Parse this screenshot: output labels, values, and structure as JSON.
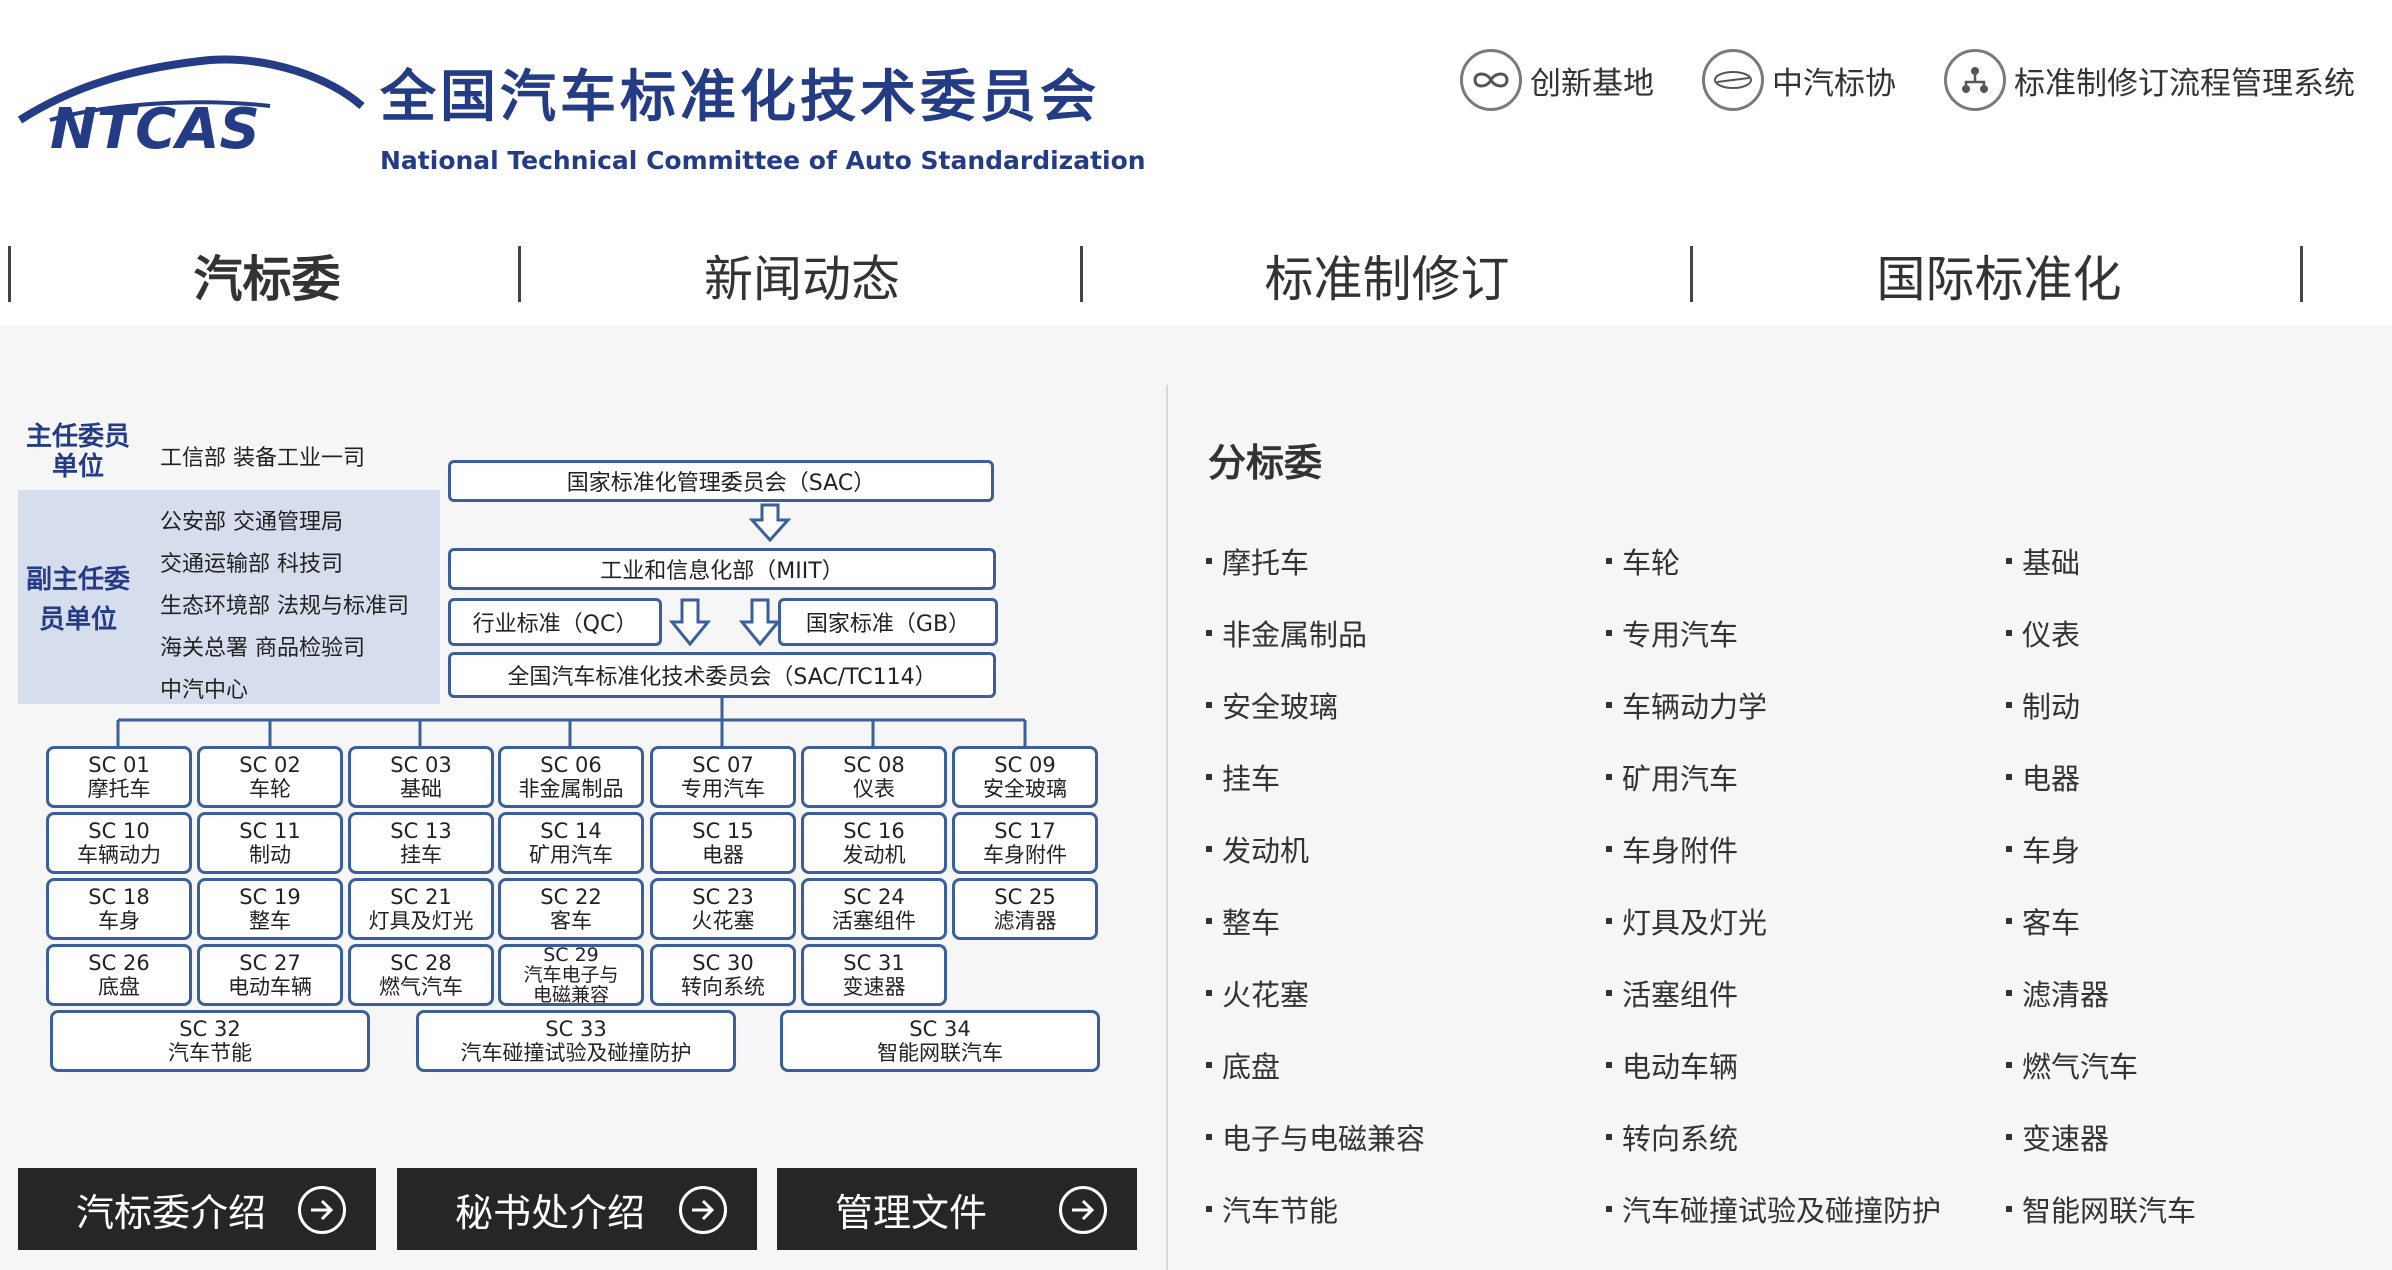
{
  "header": {
    "logo_text": "NTCAS",
    "title_cn": "全国汽车标准化技术委员会",
    "title_en": "National Technical Committee of Auto Standardization",
    "quick_links": [
      {
        "label": "创新基地",
        "icon": "infinity-link-icon"
      },
      {
        "label": "中汽标协",
        "icon": "casc-logo-icon"
      },
      {
        "label": "标准制修订流程管理系统",
        "icon": "org-flow-icon"
      }
    ]
  },
  "nav": {
    "items": [
      "汽标委",
      "新闻动态",
      "标准制修订",
      "国际标准化"
    ],
    "active": "汽标委"
  },
  "org_chart": {
    "main_label": "主任委员单位",
    "main_unit": "工信部  装备工业一司",
    "vice_label": "副主任委员单位",
    "vice_units": [
      "公安部  交通管理局",
      "交通运输部  科技司",
      "生态环境部  法规与标准司",
      "海关总署  商品检验司",
      "中汽中心"
    ],
    "sac": "国家标准化管理委员会（SAC）",
    "miit": "工业和信息化部（MIIT）",
    "qc": "行业标准（QC）",
    "gb": "国家标准（GB）",
    "tc114": "全国汽车标准化技术委员会（SAC/TC114）",
    "sc": [
      {
        "code": "SC 01",
        "name": "摩托车"
      },
      {
        "code": "SC 02",
        "name": "车轮"
      },
      {
        "code": "SC 03",
        "name": "基础"
      },
      {
        "code": "SC 06",
        "name": "非金属制品"
      },
      {
        "code": "SC 07",
        "name": "专用汽车"
      },
      {
        "code": "SC 08",
        "name": "仪表"
      },
      {
        "code": "SC 09",
        "name": "安全玻璃"
      },
      {
        "code": "SC 10",
        "name": "车辆动力"
      },
      {
        "code": "SC 11",
        "name": "制动"
      },
      {
        "code": "SC 13",
        "name": "挂车"
      },
      {
        "code": "SC 14",
        "name": "矿用汽车"
      },
      {
        "code": "SC 15",
        "name": "电器"
      },
      {
        "code": "SC 16",
        "name": "发动机"
      },
      {
        "code": "SC 17",
        "name": "车身附件"
      },
      {
        "code": "SC 18",
        "name": "车身"
      },
      {
        "code": "SC 19",
        "name": "整车"
      },
      {
        "code": "SC 21",
        "name": "灯具及灯光"
      },
      {
        "code": "SC 22",
        "name": "客车"
      },
      {
        "code": "SC 23",
        "name": "火花塞"
      },
      {
        "code": "SC 24",
        "name": "活塞组件"
      },
      {
        "code": "SC 25",
        "name": "滤清器"
      },
      {
        "code": "SC 26",
        "name": "底盘"
      },
      {
        "code": "SC 27",
        "name": "电动车辆"
      },
      {
        "code": "SC 28",
        "name": "燃气汽车"
      },
      {
        "code": "SC 29",
        "name": "汽车电子与\n电磁兼容"
      },
      {
        "code": "SC 30",
        "name": "转向系统"
      },
      {
        "code": "SC 31",
        "name": "变速器"
      },
      {
        "code": "SC 32",
        "name": "汽车节能"
      },
      {
        "code": "SC 33",
        "name": "汽车碰撞试验及碰撞防护"
      },
      {
        "code": "SC 34",
        "name": "智能网联汽车"
      }
    ]
  },
  "buttons": [
    "汽标委介绍",
    "秘书处介绍",
    "管理文件"
  ],
  "subcommittees": {
    "title": "分标委",
    "columns": [
      [
        "摩托车",
        "非金属制品",
        "安全玻璃",
        "挂车",
        "发动机",
        "整车",
        "火花塞",
        "底盘",
        "电子与电磁兼容",
        "汽车节能"
      ],
      [
        "车轮",
        "专用汽车",
        "车辆动力学",
        "矿用汽车",
        "车身附件",
        "灯具及灯光",
        "活塞组件",
        "电动车辆",
        "转向系统",
        "汽车碰撞试验及碰撞防护"
      ],
      [
        "基础",
        "仪表",
        "制动",
        "电器",
        "车身",
        "客车",
        "滤清器",
        "燃气汽车",
        "变速器",
        "智能网联汽车"
      ]
    ]
  },
  "colors": {
    "brand": "#243b86",
    "dark_button": "#262626",
    "box_border": "#3a5f9c",
    "vice_panel": "#d6dded"
  }
}
